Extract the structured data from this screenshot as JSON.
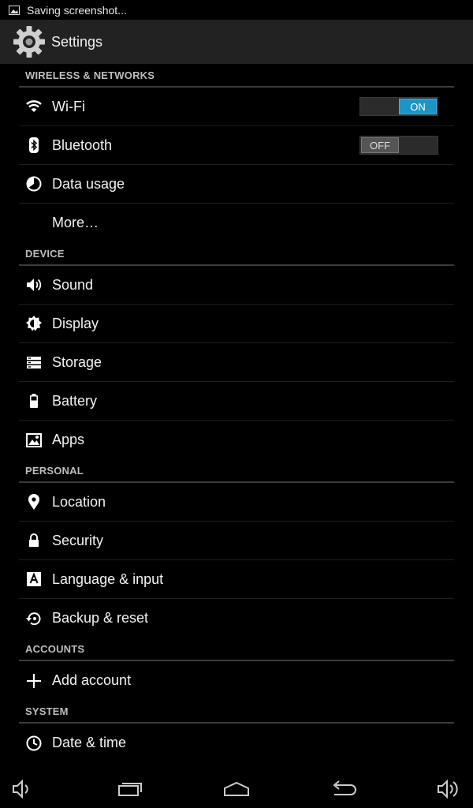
{
  "status_bar": {
    "notification_text": "Saving screenshot..."
  },
  "action_bar": {
    "title": "Settings"
  },
  "sections": {
    "wireless": {
      "header": "WIRELESS & NETWORKS",
      "wifi": {
        "label": "Wi-Fi",
        "toggle": "ON"
      },
      "bluetooth": {
        "label": "Bluetooth",
        "toggle": "OFF"
      },
      "data_usage": {
        "label": "Data usage"
      },
      "more": {
        "label": "More…"
      }
    },
    "device": {
      "header": "DEVICE",
      "sound": {
        "label": "Sound"
      },
      "display": {
        "label": "Display"
      },
      "storage": {
        "label": "Storage"
      },
      "battery": {
        "label": "Battery"
      },
      "apps": {
        "label": "Apps"
      }
    },
    "personal": {
      "header": "PERSONAL",
      "location": {
        "label": "Location"
      },
      "security": {
        "label": "Security"
      },
      "language": {
        "label": "Language & input"
      },
      "backup": {
        "label": "Backup & reset"
      }
    },
    "accounts": {
      "header": "ACCOUNTS",
      "add_account": {
        "label": "Add account"
      }
    },
    "system": {
      "header": "SYSTEM",
      "date_time": {
        "label": "Date & time"
      }
    }
  },
  "colors": {
    "accent": "#1b95c9",
    "action_bar_bg": "#222222",
    "background": "#000000"
  }
}
